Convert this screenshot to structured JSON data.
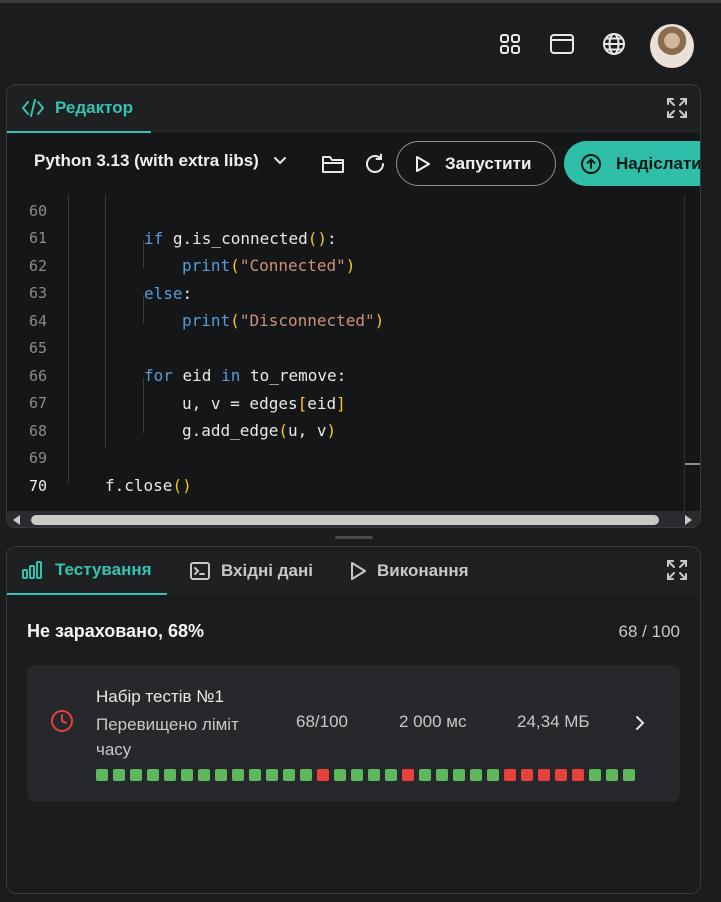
{
  "topbar": {
    "icons": [
      "grid-icon",
      "window-icon",
      "globe-icon"
    ]
  },
  "editor": {
    "tab_label": "Редактор",
    "language": "Python 3.13 (with extra libs)",
    "run_label": "Запустити",
    "submit_label": "Надіслати",
    "current_line": 70,
    "lines": [
      {
        "num": "60",
        "code": ""
      },
      {
        "num": "61",
        "code": "if g.is_connected():"
      },
      {
        "num": "62",
        "code": "print(\"Connected\")"
      },
      {
        "num": "63",
        "code": "else:"
      },
      {
        "num": "64",
        "code": "print(\"Disconnected\")"
      },
      {
        "num": "65",
        "code": ""
      },
      {
        "num": "66",
        "code": "for eid in to_remove:"
      },
      {
        "num": "67",
        "code": "u, v = edges[eid]"
      },
      {
        "num": "68",
        "code": "g.add_edge(u, v)"
      },
      {
        "num": "69",
        "code": ""
      },
      {
        "num": "70",
        "code": "f.close()"
      }
    ]
  },
  "tests": {
    "tabs": [
      "Тестування",
      "Вхідні дані",
      "Виконання"
    ],
    "verdict": "Не зараховано, 68%",
    "score": "68 / 100",
    "group": {
      "title": "Набір тестів №1",
      "status": "Перевищено ліміт часу",
      "points": "68/100",
      "time": "2 000 мс",
      "memory": "24,34 МБ",
      "results": [
        "ok",
        "ok",
        "ok",
        "ok",
        "ok",
        "ok",
        "ok",
        "ok",
        "ok",
        "ok",
        "ok",
        "ok",
        "ok",
        "bad",
        "ok",
        "ok",
        "ok",
        "ok",
        "bad",
        "ok",
        "ok",
        "ok",
        "ok",
        "ok",
        "bad",
        "bad",
        "bad",
        "bad",
        "bad",
        "ok",
        "ok",
        "ok"
      ]
    }
  },
  "colors": {
    "accent": "#35c2b0",
    "ok": "#5db85c",
    "fail": "#e8403a"
  }
}
